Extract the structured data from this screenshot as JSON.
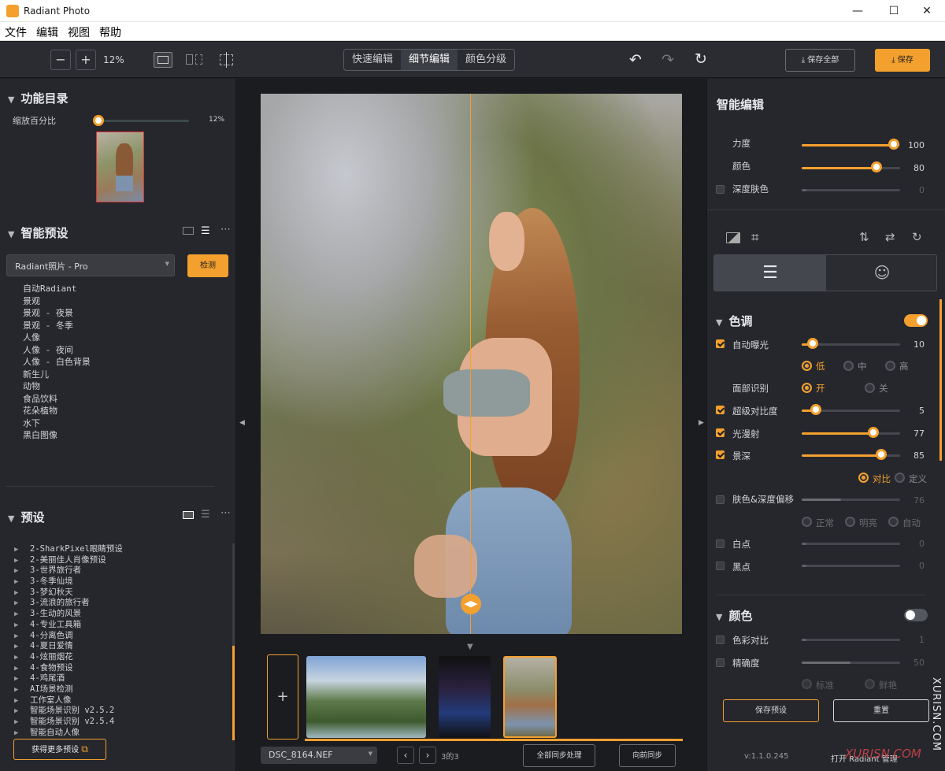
{
  "window": {
    "title": "Radiant Photo",
    "minimize": "—",
    "maximize": "☐",
    "close": "✕"
  },
  "menu": [
    "文件",
    "编辑",
    "视图",
    "帮助"
  ],
  "toolbar": {
    "zoom_minus": "−",
    "zoom_plus": "+",
    "zoom": "12%",
    "modes": [
      "快速编辑",
      "细节编辑",
      "颜色分级"
    ],
    "active_mode": "细节编辑",
    "save_all": "保存全部",
    "save": "保存"
  },
  "left": {
    "catalog_title": "功能目录",
    "zoom_label": "缩放百分比",
    "zoom_value": "12%",
    "zoom_fraction": 0.0,
    "smart_preset_title": "智能预设",
    "preset_select": "Radiant照片 - Pro",
    "detect_button": "检测",
    "smart_presets": [
      "自动Radiant",
      "景观",
      "景观 - 夜景",
      "景观 - 冬季",
      "人像",
      "人像 - 夜间",
      "人像 - 白色背景",
      "新生儿",
      "动物",
      "食品饮料",
      "花朵植物",
      "水下",
      "黑白图像"
    ],
    "presets_title": "预设",
    "presets": [
      "2-SharkPixel眼睛预设",
      "2-美丽佳人肖像预设",
      "3-世界旅行者",
      "3-冬季仙境",
      "3-梦幻秋天",
      "3-流浪的旅行者",
      "3-生动的风景",
      "4-专业工具箱",
      "4-分离色调",
      "4-夏日爱情",
      "4-炫丽烟花",
      "4-食物预设",
      "4-鸡尾酒",
      "AI场景检测",
      "工作室人像",
      "智能场景识别 v2.5.2",
      "智能场景识别 v2.5.4",
      "智能自动人像"
    ],
    "get_more": "获得更多预设"
  },
  "center": {
    "add_button": "+",
    "filename": "DSC_8164.NEF",
    "page": "3的3",
    "sync_all": "全部同步处理",
    "sync_forward": "向前同步"
  },
  "right": {
    "smart_edit_title": "智能编辑",
    "strength_label": "力度",
    "strength_value": "100",
    "color_label": "颜色",
    "color_value": "80",
    "deep_skin_label": "深度肤色",
    "deep_skin_value": "0",
    "tone_title": "色调",
    "auto_exposure_label": "自动曝光",
    "auto_exposure_value": "10",
    "exposure_levels": [
      "低",
      "中",
      "高"
    ],
    "face_detect_label": "面部识别",
    "face_options": [
      "开",
      "关"
    ],
    "super_contrast_label": "超级对比度",
    "super_contrast_value": "5",
    "light_diffuse_label": "光漫射",
    "light_diffuse_value": "77",
    "depth_label": "景深",
    "depth_value": "85",
    "depth_options": [
      "对比",
      "定义"
    ],
    "skin_shift_label": "肤色&深度偏移",
    "skin_shift_value": "76",
    "skin_options": [
      "正常",
      "明亮",
      "自动"
    ],
    "white_label": "白点",
    "white_value": "0",
    "black_label": "黑点",
    "black_value": "0",
    "color_title": "颜色",
    "color_contrast_label": "色彩对比",
    "color_contrast_value": "1",
    "precision_label": "精确度",
    "precision_value": "50",
    "precision_options": [
      "标准",
      "鲜艳"
    ],
    "save_preset": "保存预设",
    "reset": "重置",
    "version": "v:1.1.0.245",
    "open_manager": "打开 Radiant 管理",
    "watermark": "XURISN.COM",
    "watermark2": "XURISN.COM"
  },
  "colors": {
    "accent": "#f3a02f",
    "panel": "#26272c",
    "toolbar": "#2b2c31"
  }
}
